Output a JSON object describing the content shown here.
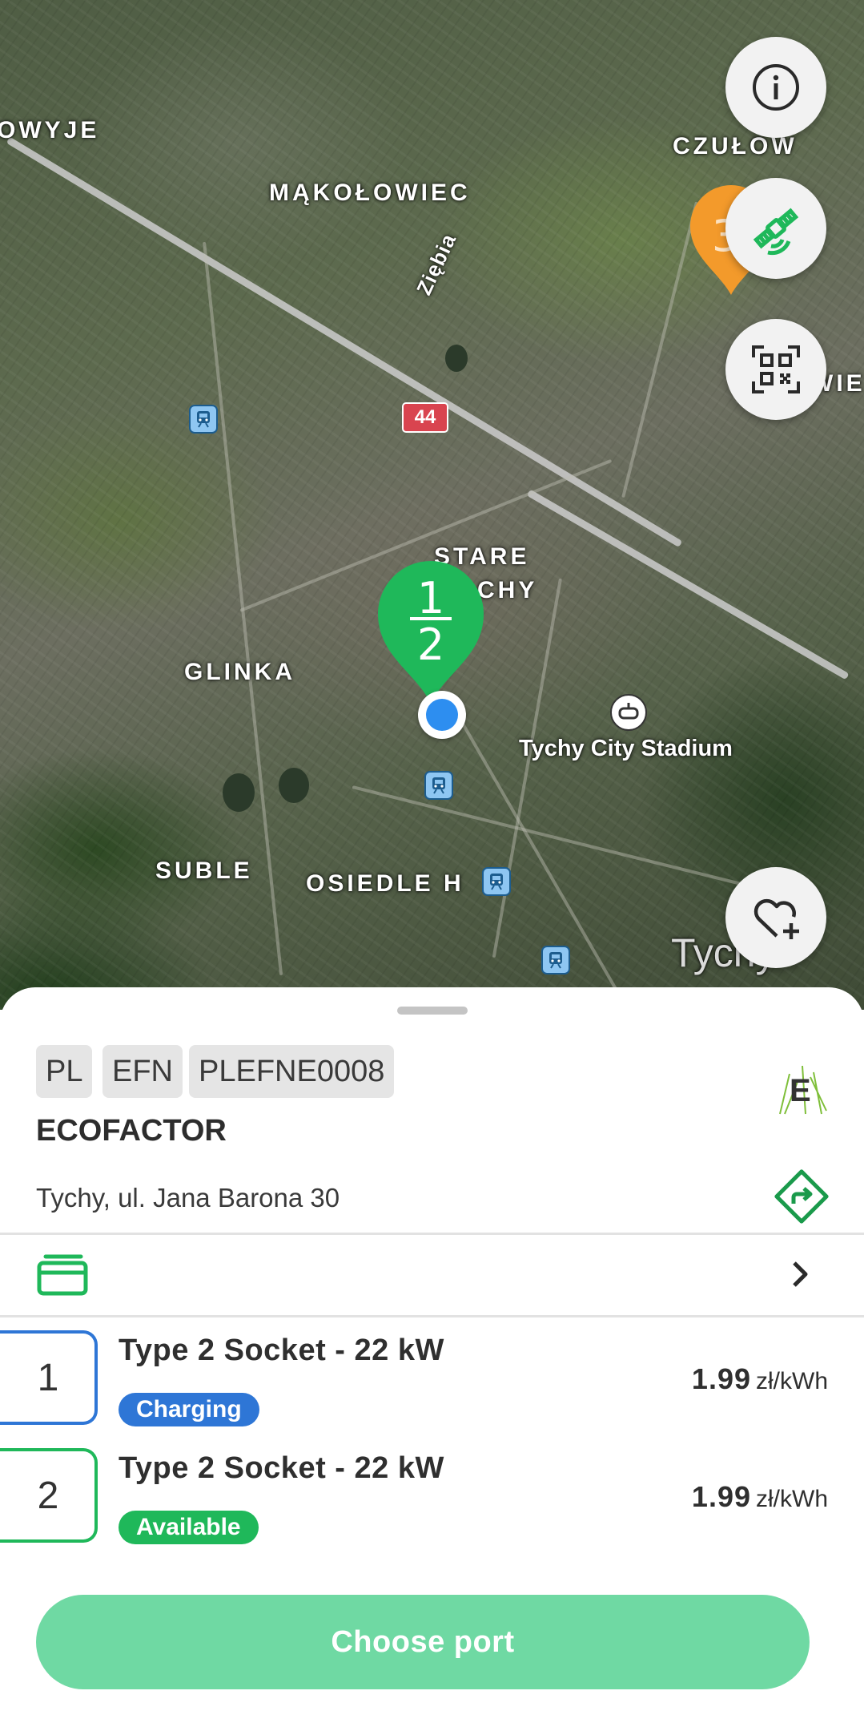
{
  "map": {
    "labels": {
      "owyje": "OWYJE",
      "czulow": "CZUŁOW",
      "makolowiec": "MĄKOŁOWIEC",
      "ziebia": "Ziębia",
      "wier": "WIE",
      "route": "44",
      "stare_tychy_1": "STARE",
      "stare_tychy_2": "CHY",
      "glinka": "GLINKA",
      "stadium": "Tychy City Stadium",
      "suble": "SUBLE",
      "osiedle_h": "OSIEDLE H",
      "city": "Tychy"
    },
    "selected_pin": {
      "available": "1",
      "total": "2",
      "color": "#1fb85a"
    },
    "other_pin": {
      "label": "3",
      "color": "#f39a2b"
    }
  },
  "fabs": {
    "info": "info-icon",
    "satellite": "satellite-icon",
    "qr": "qr-code-icon",
    "favorite": "heart-plus-icon"
  },
  "station": {
    "chips": [
      "PL",
      "EFN",
      "PLEFNE0008"
    ],
    "operator": "ECOFACTOR",
    "logo_letter": "E",
    "address": "Tychy, ul. Jana Barona 30"
  },
  "ports": [
    {
      "number": "1",
      "title": "Type 2 Socket - 22 kW",
      "status": "Charging",
      "status_color": "#2e76d6",
      "price": "1.99",
      "unit": "zł/kWh"
    },
    {
      "number": "2",
      "title": "Type 2 Socket - 22 kW",
      "status": "Available",
      "status_color": "#1fb85a",
      "price": "1.99",
      "unit": "zł/kWh"
    }
  ],
  "cta": {
    "label": "Choose port"
  },
  "colors": {
    "accent": "#1fb85a",
    "cta_disabled": "#6fd9a3",
    "charging": "#2e76d6"
  }
}
